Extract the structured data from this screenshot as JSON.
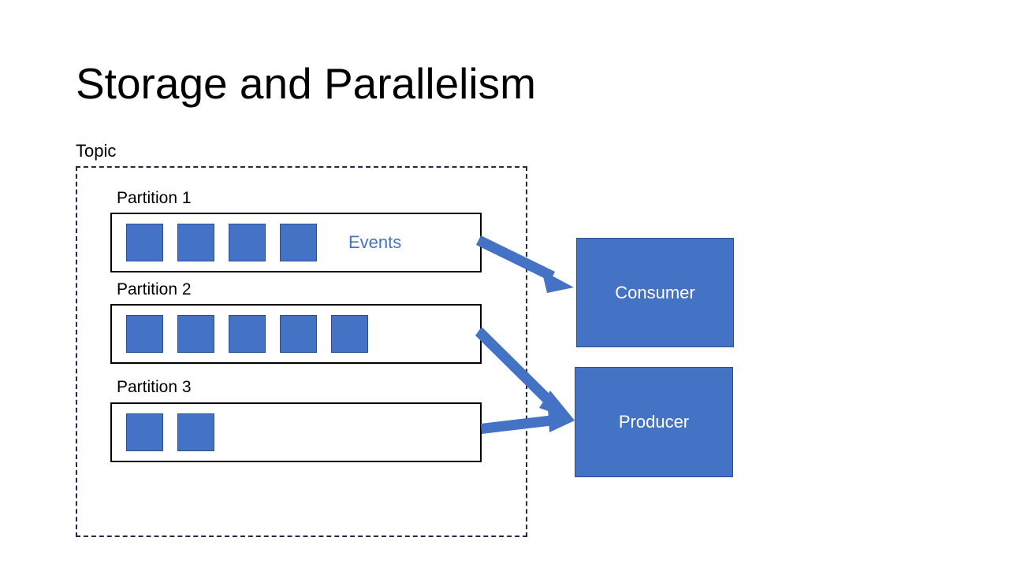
{
  "slide": {
    "title": "Storage and Parallelism",
    "background_color": "#FFFFFF"
  },
  "topic": {
    "label": "Topic",
    "border_style": "dashed",
    "border_color": "#1F2A44"
  },
  "colors": {
    "accent_blue": "#4472C4",
    "event_border": "#2D4F8E",
    "partition_border": "#000000",
    "text_dark": "#000000",
    "text_on_accent": "#FFFFFF"
  },
  "partitions": [
    {
      "label": "Partition 1",
      "event_count": 4,
      "events_label": "Events"
    },
    {
      "label": "Partition 2",
      "event_count": 5,
      "events_label": ""
    },
    {
      "label": "Partition 3",
      "event_count": 2,
      "events_label": ""
    }
  ],
  "nodes": [
    {
      "label": "Consumer"
    },
    {
      "label": "Producer"
    }
  ],
  "connections": [
    {
      "from": "Partition 1",
      "to": "Consumer"
    },
    {
      "from": "Partition 2",
      "to": "Producer"
    },
    {
      "from": "Partition 3",
      "to": "Producer"
    }
  ]
}
